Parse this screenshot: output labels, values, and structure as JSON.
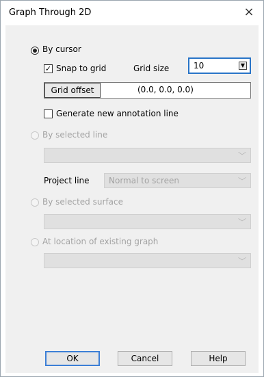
{
  "window": {
    "title": "Graph Through 2D",
    "close_icon": "×"
  },
  "by_cursor": {
    "label": "By cursor",
    "snap_label": "Snap to grid",
    "grid_size_label": "Grid size",
    "grid_size_value": "10",
    "grid_offset_button": "Grid offset",
    "grid_offset_value": "(0.0, 0.0, 0.0)",
    "generate_label": "Generate new annotation line"
  },
  "by_selected_line": {
    "label": "By selected line",
    "project_line_label": "Project line",
    "project_line_value": "Normal to screen"
  },
  "by_selected_surface": {
    "label": "By selected surface"
  },
  "at_location": {
    "label": "At location of existing graph"
  },
  "buttons": {
    "ok": "OK",
    "cancel": "Cancel",
    "help": "Help"
  },
  "colors": {
    "accent": "#2874c7",
    "disabled_text": "#a3a3a3",
    "panel": "#f0f0f0"
  },
  "icons": {
    "spinner": "spinner-down-icon",
    "chevron": "chevron-down-icon",
    "close": "close-icon"
  }
}
